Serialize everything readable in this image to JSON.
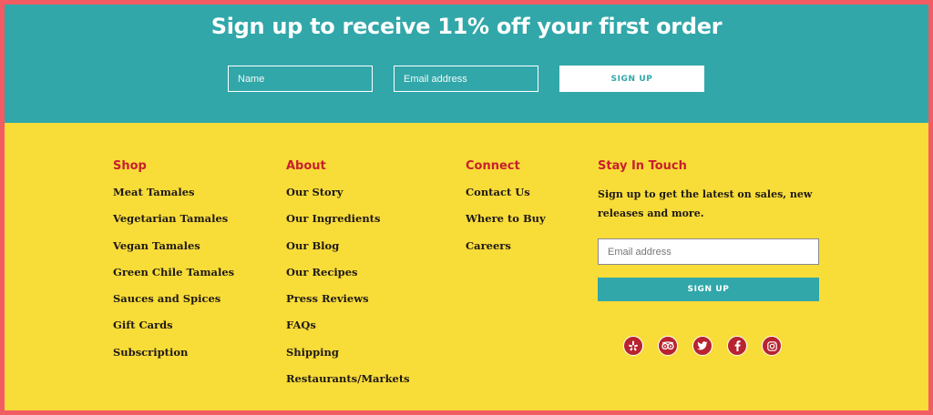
{
  "signup_band": {
    "title": "Sign up to receive 11% off your first order",
    "name_placeholder": "Name",
    "email_placeholder": "Email address",
    "button_label": "SIGN UP"
  },
  "footer": {
    "shop": {
      "heading": "Shop",
      "links": [
        "Meat Tamales",
        "Vegetarian Tamales",
        "Vegan Tamales",
        "Green Chile Tamales",
        "Sauces and Spices",
        "Gift Cards",
        "Subscription"
      ]
    },
    "about": {
      "heading": "About",
      "links": [
        "Our Story",
        "Our Ingredients",
        "Our Blog",
        "Our Recipes",
        "Press Reviews",
        "FAQs",
        "Shipping",
        "Restaurants/Markets"
      ]
    },
    "connect": {
      "heading": "Connect",
      "links": [
        "Contact Us",
        "Where to Buy",
        "Careers"
      ]
    },
    "stay_in_touch": {
      "heading": "Stay In Touch",
      "description": "Sign up to get the latest on sales, new releases and more.",
      "email_placeholder": "Email address",
      "button_label": "SIGN UP",
      "social_icons": [
        "yelp-icon",
        "tripadvisor-icon",
        "twitter-icon",
        "facebook-icon",
        "instagram-icon"
      ]
    }
  },
  "colors": {
    "page_border": "#f25c63",
    "teal": "#31a7a9",
    "yellow": "#f8dc38",
    "heading_red": "#c8202e",
    "icon_red": "#b8232f",
    "text_dark": "#1f1a17"
  }
}
